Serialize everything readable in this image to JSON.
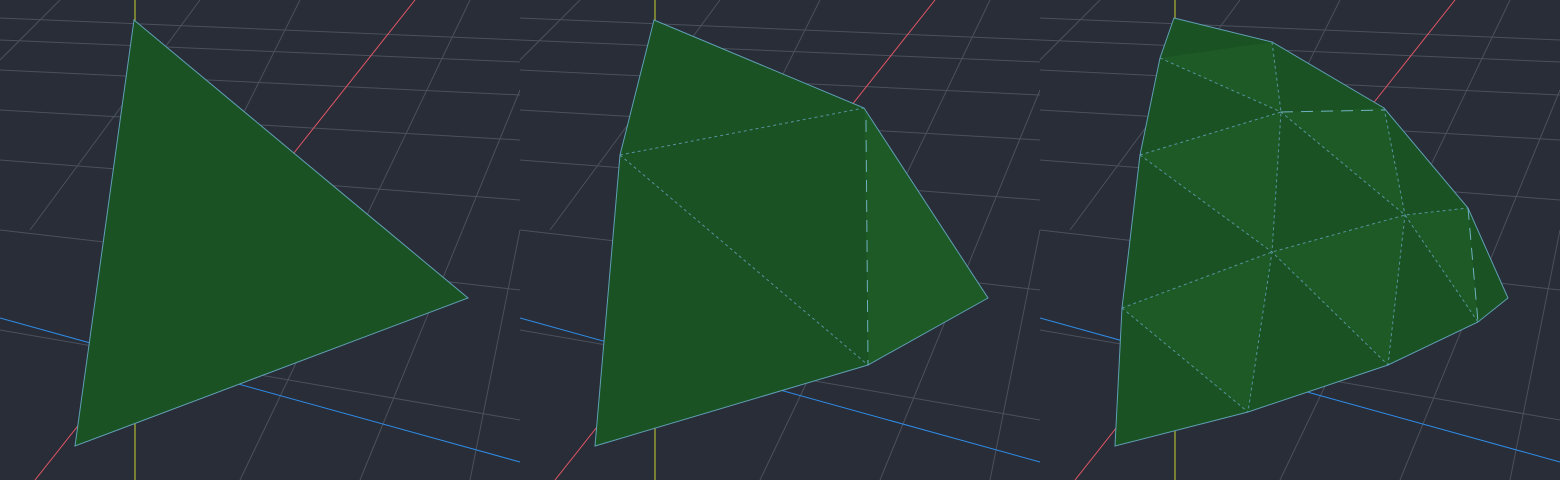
{
  "colors": {
    "background": "#282d37",
    "grid": "#4b515c",
    "grid_far": "#6f7580",
    "axis_x": "#e05565",
    "axis_y": "#c8d432",
    "axis_z": "#2f8ce8",
    "face": "#1b5223",
    "face_alt": "#1d5a26",
    "edge": "#5f9fb4",
    "hidden_edge": "#6fb0c0"
  },
  "viewports": [
    {
      "label": "",
      "subdivision_level": 0,
      "mesh": "triangle"
    },
    {
      "label": "",
      "subdivision_level": 1,
      "mesh": "subdivided-triangle"
    },
    {
      "label": "",
      "subdivision_level": 2,
      "mesh": "subdivided-triangle"
    }
  ]
}
